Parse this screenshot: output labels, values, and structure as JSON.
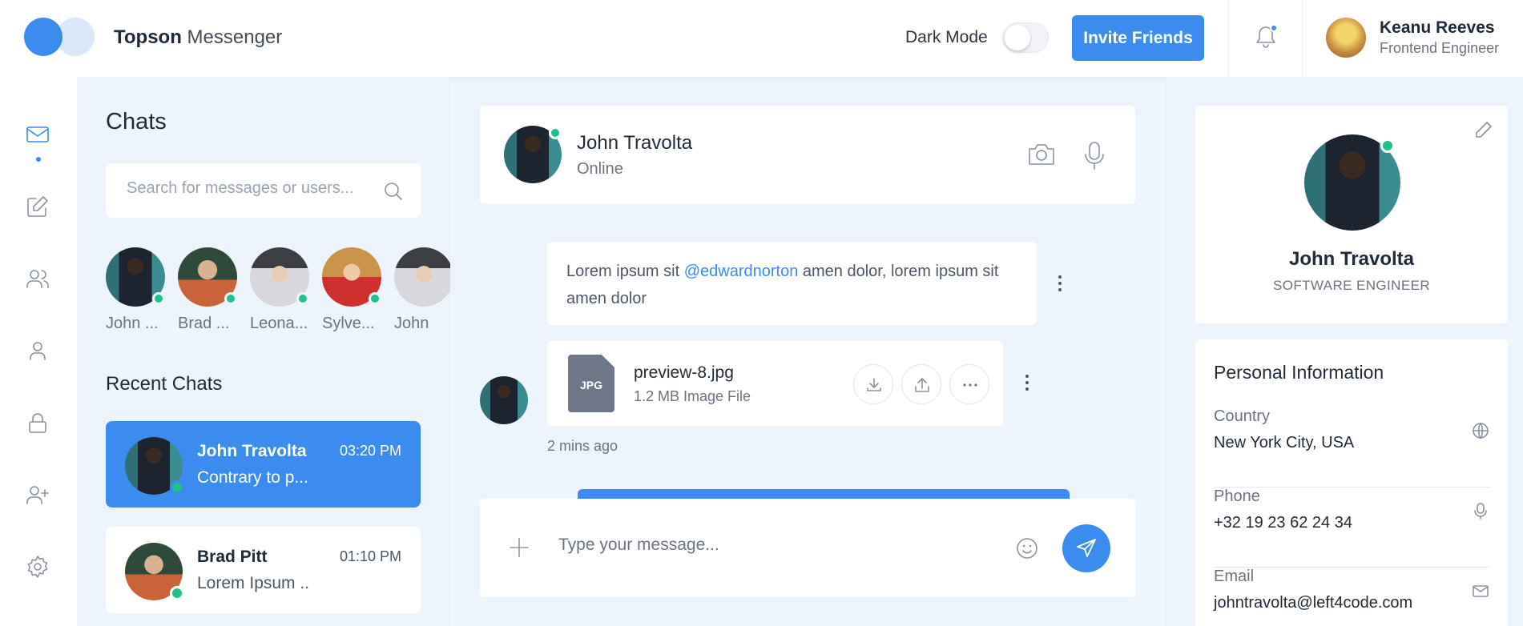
{
  "app": {
    "brand_strong": "Topson",
    "brand_light": "Messenger",
    "dark_mode_label": "Dark Mode",
    "dark_mode_on": false,
    "invite_label": "Invite Friends",
    "notifications_unread": true,
    "user": {
      "name": "Keanu Reeves",
      "role": "Frontend Engineer"
    }
  },
  "nav": {
    "items": [
      "mail-icon",
      "edit-icon",
      "users-icon",
      "user-icon",
      "lock-icon",
      "user-plus-icon",
      "settings-icon"
    ],
    "active": "mail-icon"
  },
  "chats": {
    "title": "Chats",
    "search_placeholder": "Search for messages or users...",
    "stories": [
      {
        "name": "John ...",
        "online": true
      },
      {
        "name": "Brad ...",
        "online": true
      },
      {
        "name": "Leona...",
        "online": true
      },
      {
        "name": "Sylve...",
        "online": true
      },
      {
        "name": "John",
        "online": false
      }
    ],
    "recent_title": "Recent Chats",
    "recent": [
      {
        "name": "John Travolta",
        "message": "Contrary to p...",
        "time": "03:20 PM",
        "active": true
      },
      {
        "name": "Brad Pitt",
        "message": "Lorem Ipsum ...",
        "time": "01:10 PM",
        "active": false
      }
    ]
  },
  "conversation": {
    "contact_name": "John Travolta",
    "contact_status": "Online",
    "message_text_1": "Lorem ipsum sit ",
    "message_mention": "@edwardnorton",
    "message_text_2": " amen dolor, lorem ipsum sit amen dolor",
    "file": {
      "type_label": "JPG",
      "name": "preview-8.jpg",
      "size": "1.2 MB Image File"
    },
    "time_ago": "2 mins ago",
    "composer_placeholder": "Type your message..."
  },
  "profile": {
    "name": "John Travolta",
    "role": "SOFTWARE ENGINEER",
    "info_title": "Personal Information",
    "fields": [
      {
        "label": "Country",
        "value": "New York City, USA",
        "icon": "globe-icon"
      },
      {
        "label": "Phone",
        "value": "+32 19 23 62 24 34",
        "icon": "mic-icon"
      },
      {
        "label": "Email",
        "value": "johntravolta@left4code.com",
        "icon": "mail-icon"
      }
    ]
  },
  "colors": {
    "accent": "#3b8cee",
    "online": "#22c08a",
    "background": "#eef4fc"
  }
}
